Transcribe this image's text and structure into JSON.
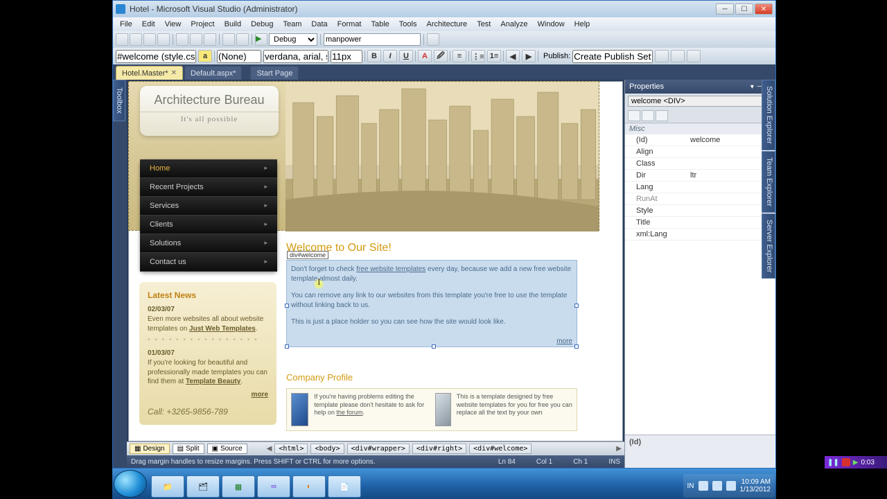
{
  "window": {
    "title": "Hotel - Microsoft Visual Studio (Administrator)"
  },
  "menu": [
    "File",
    "Edit",
    "View",
    "Project",
    "Build",
    "Debug",
    "Team",
    "Data",
    "Format",
    "Table",
    "Tools",
    "Architecture",
    "Test",
    "Analyze",
    "Window",
    "Help"
  ],
  "toolbar": {
    "config": "Debug",
    "find": "manpower"
  },
  "format_bar": {
    "css_selector": "#welcome (style.css)",
    "style_rule": "(None)",
    "font_family": "verdana, arial, sar",
    "font_size": "11px",
    "publish_label": "Publish:",
    "publish_target": "Create Publish Settings"
  },
  "tabs": [
    {
      "label": "Hotel.Master*",
      "active": true
    },
    {
      "label": "Default.aspx*",
      "active": false
    },
    {
      "label": "Start Page",
      "active": false
    }
  ],
  "left_rail": "Toolbox",
  "right_rail": [
    "Solution Explorer",
    "Team Explorer",
    "Server Explorer"
  ],
  "page": {
    "logo_title": "Architecture Bureau",
    "logo_tag": "It's all possible",
    "nav": [
      "Home",
      "Recent Projects",
      "Services",
      "Clients",
      "Solutions",
      "Contact us"
    ],
    "news_title": "Latest News",
    "news": [
      {
        "date": "02/03/07",
        "text": "Even more websites all about website templates on ",
        "link": "Just Web Templates",
        "tail": "."
      },
      {
        "date": "01/03/07",
        "text": "If you're looking for beautiful and professionally made templates you can find them at ",
        "link": "Template Beauty",
        "tail": "."
      }
    ],
    "more": "more",
    "call": "Call: +3265-9856-789",
    "welcome_heading": "Welcome to Our Site!",
    "welcome_tag": "div#welcome",
    "welcome_p1a": "Don't forget to check ",
    "welcome_p1_link": "free website templates",
    "welcome_p1b": " every day, because we add a new free website template almost daily.",
    "welcome_p2": "You can remove any link to our websites from this template you're free to use the template without linking back to us.",
    "welcome_p3": "This is just a place holder so you can see how the site would look like.",
    "profile_heading": "Company Profile",
    "profile_text1": "If you're having problems editing the template please don't hesitate to ask for help on ",
    "profile_link1": "the forum",
    "profile_text2": "This is a template designed by free website templates for you for free you can replace all the text by your own"
  },
  "views": {
    "design": "Design",
    "split": "Split",
    "source": "Source"
  },
  "breadcrumbs": [
    "<html>",
    "<body>",
    "<div#wrapper>",
    "<div#right>",
    "<div#welcome>"
  ],
  "status": {
    "hint": "Drag margin handles to resize margins. Press SHIFT or CTRL for more options.",
    "ln": "Ln 84",
    "col": "Col 1",
    "ch": "Ch 1",
    "ins": "INS"
  },
  "properties": {
    "title": "Properties",
    "selector": "welcome <DIV>",
    "category": "Misc",
    "rows": [
      {
        "k": "(Id)",
        "v": "welcome"
      },
      {
        "k": "Align",
        "v": ""
      },
      {
        "k": "Class",
        "v": ""
      },
      {
        "k": "Dir",
        "v": "ltr"
      },
      {
        "k": "Lang",
        "v": ""
      },
      {
        "k": "RunAt",
        "v": "",
        "ro": true
      },
      {
        "k": "Style",
        "v": ""
      },
      {
        "k": "Title",
        "v": ""
      },
      {
        "k": "xml:Lang",
        "v": ""
      }
    ],
    "desc": "(Id)"
  },
  "tray": {
    "lang": "IN",
    "time": "10:09 AM",
    "date": "1/13/2012"
  },
  "recorder": "0:03"
}
